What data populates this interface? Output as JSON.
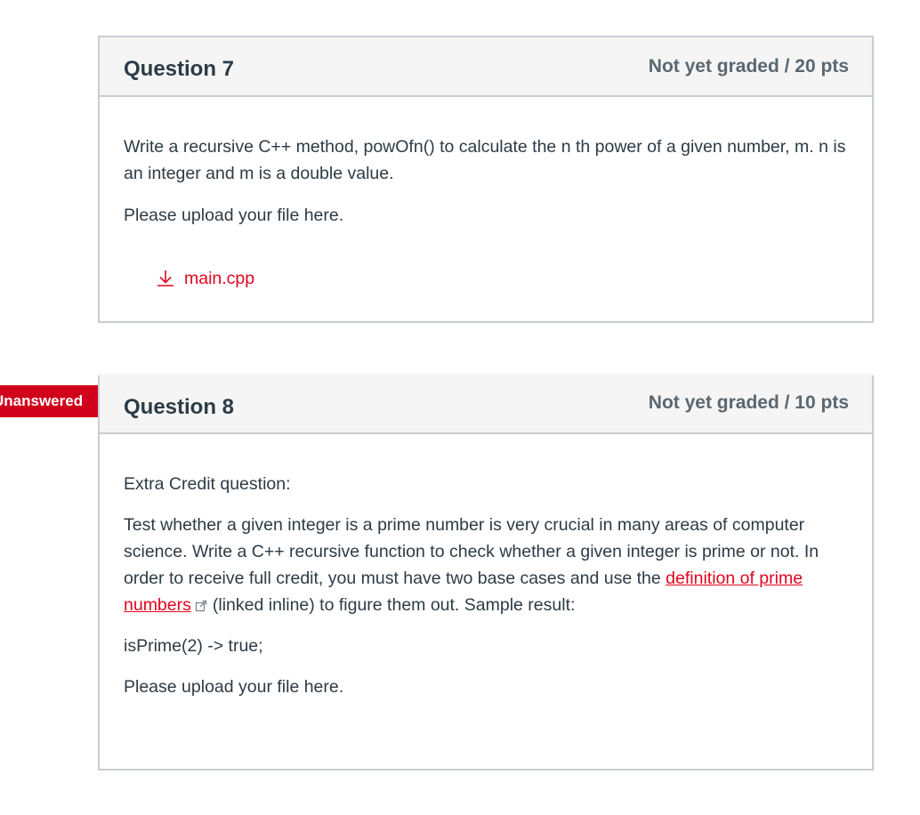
{
  "questions": [
    {
      "title": "Question 7",
      "points": "Not yet graded / 20 pts",
      "text": "Write a recursive C++ method, powOfn() to calculate the n th power of a given number, m. n is an integer and m is a double value.",
      "upload_prompt": "Please upload your file here.",
      "attachment": {
        "name": "main.cpp",
        "icon": "download-icon"
      }
    },
    {
      "flag": "Unanswered",
      "title": "Question 8",
      "points": "Not yet graded / 10 pts",
      "intro": "Extra Credit question:",
      "text_before_link": "Test whether a given integer is a prime number is very crucial in many areas of computer science. Write a C++ recursive function to check whether a given integer is prime or not. In order to receive full credit, you must have two base cases and use the ",
      "link_text": "definition of prime numbers",
      "link_icon": "external-link-icon",
      "text_after_link": "(linked inline) to figure them out. Sample result:",
      "sample": "isPrime(2) -> true;",
      "upload_prompt": "Please upload your file here."
    }
  ],
  "colors": {
    "accent": "#e0061f",
    "flag": "#d0021b",
    "border": "#c7cdd1",
    "header_bg": "#f5f5f5",
    "text": "#2d3b45"
  }
}
